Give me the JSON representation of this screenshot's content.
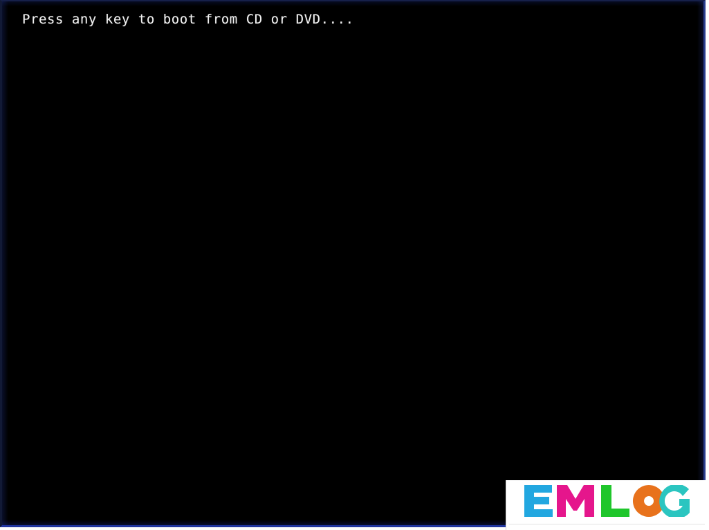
{
  "screen": {
    "type": "bios-boot-prompt",
    "background_color": "#000000",
    "border_color": "#2136a0"
  },
  "boot": {
    "message": "Press any key to boot from CD or DVD....",
    "text_color": "#f2f2f2"
  },
  "watermark": {
    "panel_background": "#ffffff",
    "brand": "EMLOG",
    "letters": [
      {
        "char": "E",
        "color": "#22a7e0"
      },
      {
        "char": "M",
        "color": "#e5168c"
      },
      {
        "char": "L",
        "color": "#1fc62b"
      },
      {
        "char": "O",
        "color": "#e8721c"
      },
      {
        "char": "G",
        "color": "#2bc5c0"
      }
    ]
  }
}
